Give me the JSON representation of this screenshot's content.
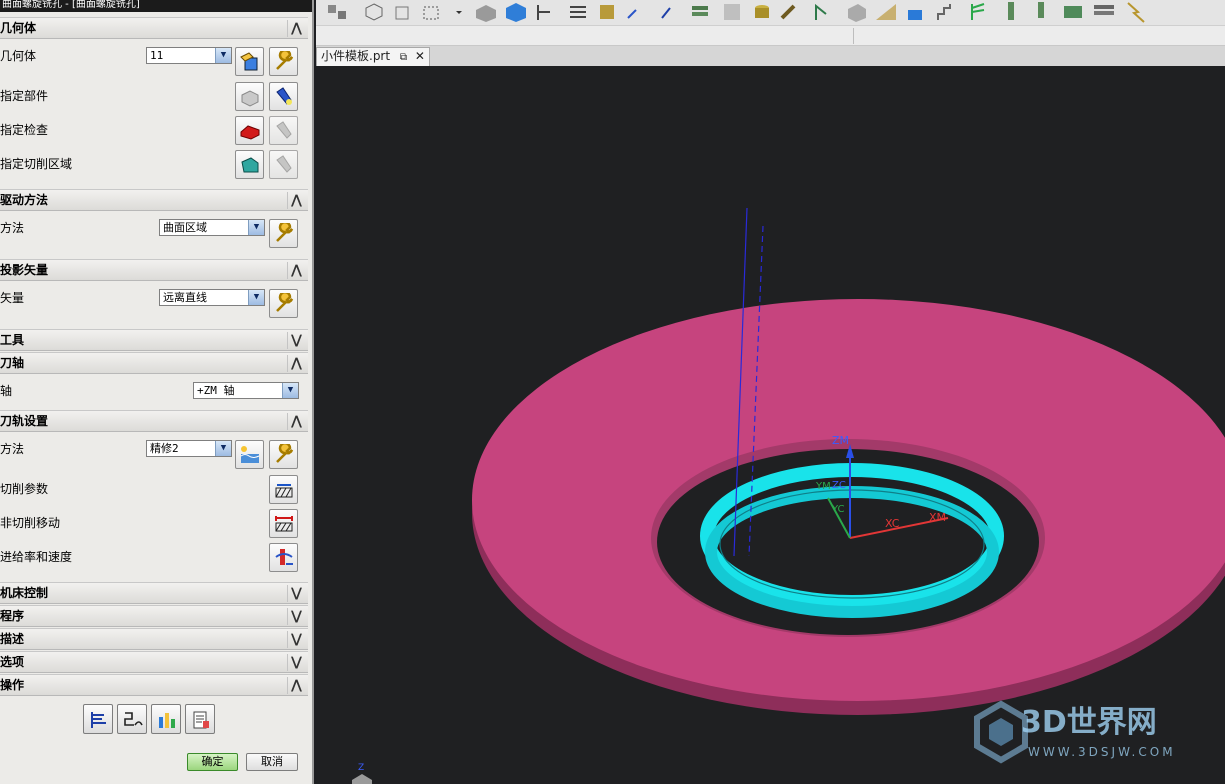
{
  "dialog": {
    "title": "曲面螺旋铣孔 - [曲面螺旋铣孔]",
    "sections": {
      "geometry": "几何体",
      "drive": "驱动方法",
      "projection": "投影矢量",
      "tool": "工具",
      "tool_axis": "刀轴",
      "path_settings": "刀轨设置",
      "machine": "机床控制",
      "program": "程序",
      "description": "描述",
      "options": "选项",
      "actions": "操作"
    },
    "geometry": {
      "label": "几何体",
      "value": "11",
      "part_label": "指定部件",
      "check_label": "指定检查",
      "cut_area_label": "指定切削区域"
    },
    "drive": {
      "label": "方法",
      "value": "曲面区域"
    },
    "projection": {
      "label": "矢量",
      "value": "远离直线"
    },
    "tool_axis": {
      "label": "轴",
      "value": "+ZM 轴"
    },
    "path_settings": {
      "method_label": "方法",
      "method_value": "精修2",
      "cut_params": "切削参数",
      "non_cut": "非切削移动",
      "feeds": "进给率和速度"
    },
    "buttons": {
      "ok": "确定",
      "cancel": "取消"
    }
  },
  "viewport": {
    "tab_label": "小件模板.prt",
    "axes": {
      "zm": "ZM",
      "yc": "YC",
      "xc": "XC",
      "xm": "XM",
      "ym": "YM",
      "zc": "ZC",
      "z_small": "Z"
    },
    "colors": {
      "part": "#c6447e",
      "part_side": "#8e2e5a",
      "toolpath": "#19e3ea",
      "background": "#1f2022"
    }
  },
  "watermark": {
    "brand": "3D世界网",
    "url": "WWW.3DSJW.COM"
  }
}
